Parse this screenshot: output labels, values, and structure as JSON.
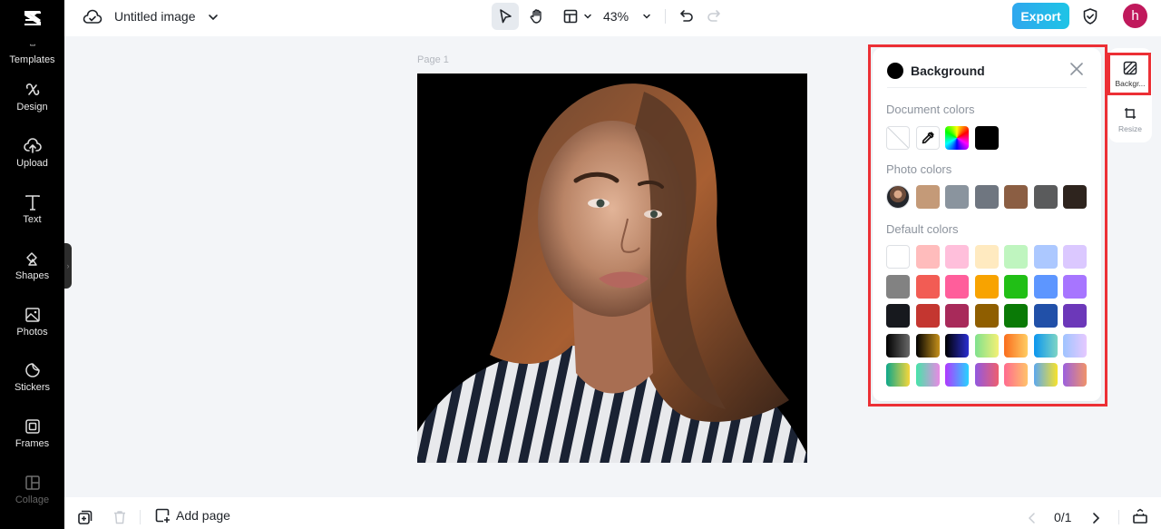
{
  "app": {
    "title": "Untitled image",
    "zoom_level": "43%",
    "export_label": "Export",
    "avatar_initial": "h"
  },
  "sidebar": {
    "items": [
      {
        "label": "Templates",
        "icon": "templates-icon"
      },
      {
        "label": "Design",
        "icon": "design-icon"
      },
      {
        "label": "Upload",
        "icon": "upload-icon"
      },
      {
        "label": "Text",
        "icon": "text-icon"
      },
      {
        "label": "Shapes",
        "icon": "shapes-icon"
      },
      {
        "label": "Photos",
        "icon": "photos-icon"
      },
      {
        "label": "Stickers",
        "icon": "stickers-icon"
      },
      {
        "label": "Frames",
        "icon": "frames-icon"
      },
      {
        "label": "Collage",
        "icon": "collage-icon"
      }
    ]
  },
  "canvas": {
    "page_label": "Page 1",
    "background_color": "#000000"
  },
  "background_panel": {
    "title": "Background",
    "current_color": "#000000",
    "sections": {
      "document": {
        "label": "Document colors",
        "swatches": [
          "none",
          "eyedropper",
          "rainbow-picker",
          "#000000"
        ]
      },
      "photo": {
        "label": "Photo colors",
        "swatches": [
          "photo-thumbnail",
          "#c49a78",
          "#8a949e",
          "#6f7680",
          "#8b5e43",
          "#5a5b5c",
          "#2e241e"
        ]
      },
      "default": {
        "label": "Default colors",
        "rows": [
          [
            "#ffffff",
            "#ffbcbc",
            "#ffbfdb",
            "#ffeac0",
            "#bff5bf",
            "#acc8ff",
            "#dbc8ff"
          ],
          [
            "#828282",
            "#f25c54",
            "#ff5e9b",
            "#f8a300",
            "#21bf16",
            "#5d96ff",
            "#a775ff"
          ],
          [
            "#17191e",
            "#c43630",
            "#a82a5a",
            "#8f5e00",
            "#0a7a06",
            "#2150a8",
            "#6c38b9"
          ],
          [
            "linear-gradient(90deg,#000,#686868)",
            "linear-gradient(90deg,#000,#c6911b)",
            "linear-gradient(90deg,#000,#2a2ed0)",
            "linear-gradient(90deg,#7fe18e,#f4f075)",
            "linear-gradient(90deg,#fa6d1d,#ffcd63)",
            "linear-gradient(90deg,#0b96ef,#7fd5c4)",
            "linear-gradient(90deg,#9fc4ff,#e6c9ff)"
          ],
          [
            "linear-gradient(90deg,#0ea78a,#f6d63b)",
            "linear-gradient(90deg,#46e3a9,#e88ae4)",
            "linear-gradient(90deg,#b138ff,#27d3ff)",
            "linear-gradient(90deg,#9158e0,#ee5f6f)",
            "linear-gradient(90deg,#ff6b8f,#ffc36a)",
            "linear-gradient(90deg,#5ca8ee,#f7e22c)",
            "linear-gradient(90deg,#9b60de,#f0936a)"
          ]
        ]
      }
    }
  },
  "right_rail": {
    "items": [
      {
        "label": "Backgr...",
        "icon": "background-icon",
        "active": true
      },
      {
        "label": "Resize",
        "icon": "resize-icon",
        "active": false
      }
    ]
  },
  "bottom_bar": {
    "add_page_label": "Add page",
    "page_indicator": "0/1"
  }
}
